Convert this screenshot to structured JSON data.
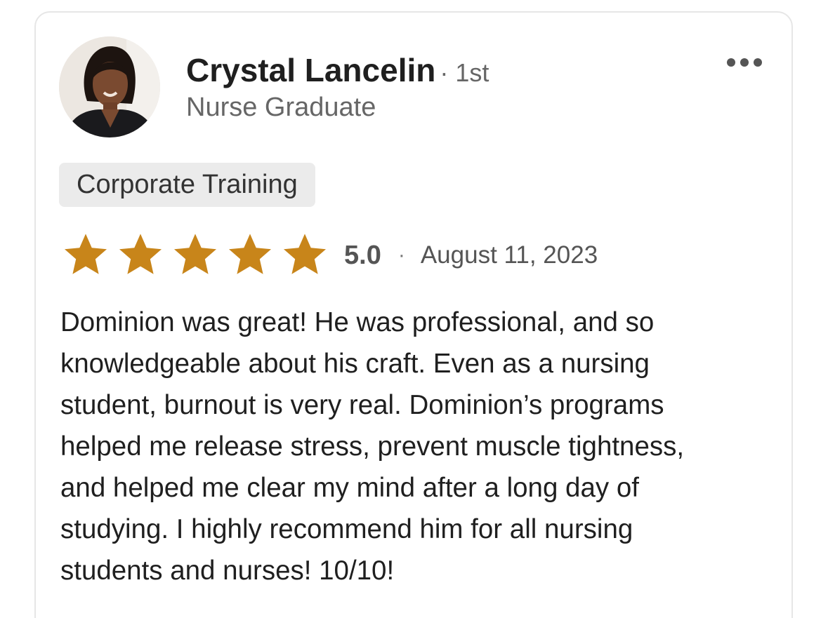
{
  "reviewer": {
    "name": "Crystal Lancelin",
    "connection_degree": "· 1st",
    "headline": "Nurse Graduate",
    "avatar_icon": "profile-photo"
  },
  "more_menu": {
    "icon": "more-horizontal-icon"
  },
  "service_tag": "Corporate Training",
  "rating": {
    "value": "5.0",
    "stars": 5,
    "max_stars": 5,
    "star_color": "#c8851a",
    "separator": "·",
    "date": "August 11, 2023"
  },
  "review_text": "Dominion was great! He was professional, and so\nknowledgeable about his craft. Even as a nursing\nstudent, burnout is very real. Dominion’s programs\nhelped me release stress, prevent muscle tightness,\nand helped me clear my mind after a long day of\nstudying. I highly recommend him for all nursing\nstudents and nurses! 10/10!"
}
